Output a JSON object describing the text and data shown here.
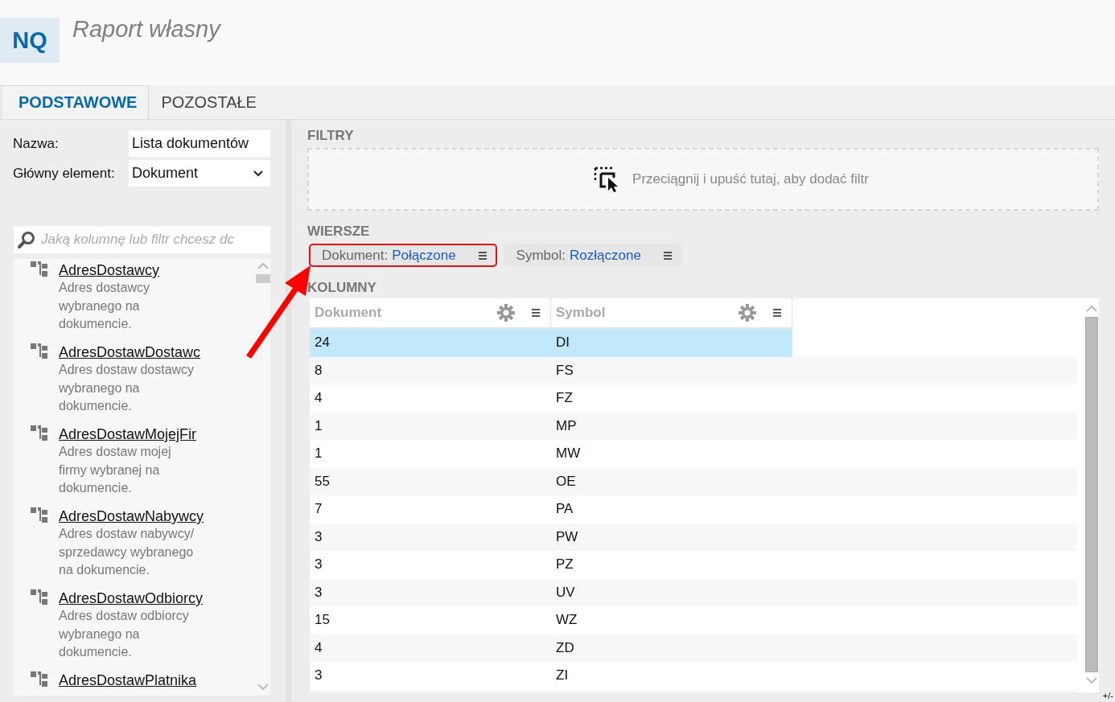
{
  "header": {
    "badge": "NQ",
    "title": "Raport własny"
  },
  "tabs": [
    {
      "label": "PODSTAWOWE",
      "selected": true
    },
    {
      "label": "POZOSTAŁE",
      "selected": false
    }
  ],
  "form": [
    {
      "label": "Nazwa:",
      "kind": "text",
      "value": "Lista dokumentów"
    },
    {
      "label": "Główny element:",
      "kind": "select",
      "value": "Dokument"
    }
  ],
  "search": {
    "placeholder": "Jaką kolumnę lub filtr chcesz dc"
  },
  "fields": [
    {
      "name": "AdresDostawcy",
      "description": "Adres dostawcy wybranego na dokumencie."
    },
    {
      "name": "AdresDostawDostawc",
      "description": "Adres dostaw dostawcy wybranego na dokumencie."
    },
    {
      "name": "AdresDostawMojejFir",
      "description": "Adres dostaw mojej firmy wybranej na dokumencie."
    },
    {
      "name": "AdresDostawNabywcy",
      "description": "Adres dostaw nabywcy/ sprzedawcy wybranego na dokumencie."
    },
    {
      "name": "AdresDostawOdbiorcy",
      "description": "Adres dostaw odbiorcy wybranego na dokumencie."
    },
    {
      "name": "AdresDostawPlatnika"
    }
  ],
  "filters": {
    "heading": "FILTRY",
    "hint": "Przeciągnij i upuść tutaj, aby dodać filtr"
  },
  "rows_section": {
    "heading": "WIERSZE",
    "chips": [
      {
        "field": "Dokument:",
        "mode": "Połączone",
        "highlighted": true
      },
      {
        "field": "Symbol:",
        "mode": "Rozłączone",
        "highlighted": false
      }
    ]
  },
  "columns_section": {
    "heading": "KOLUMNY"
  },
  "table": {
    "columns": [
      "Dokument",
      "Symbol"
    ],
    "rows": [
      {
        "cells": [
          "24",
          "DI"
        ],
        "selected": true
      },
      {
        "cells": [
          "8",
          "FS"
        ],
        "selected": false
      },
      {
        "cells": [
          "4",
          "FZ"
        ],
        "selected": false
      },
      {
        "cells": [
          "1",
          "MP"
        ],
        "selected": false
      },
      {
        "cells": [
          "1",
          "MW"
        ],
        "selected": false
      },
      {
        "cells": [
          "55",
          "OE"
        ],
        "selected": false
      },
      {
        "cells": [
          "7",
          "PA"
        ],
        "selected": false
      },
      {
        "cells": [
          "3",
          "PW"
        ],
        "selected": false
      },
      {
        "cells": [
          "3",
          "PZ"
        ],
        "selected": false
      },
      {
        "cells": [
          "3",
          "UV"
        ],
        "selected": false
      },
      {
        "cells": [
          "15",
          "WZ"
        ],
        "selected": false
      },
      {
        "cells": [
          "4",
          "ZD"
        ],
        "selected": false
      },
      {
        "cells": [
          "3",
          "ZI"
        ],
        "selected": false
      }
    ]
  },
  "corner_label": "+/-"
}
